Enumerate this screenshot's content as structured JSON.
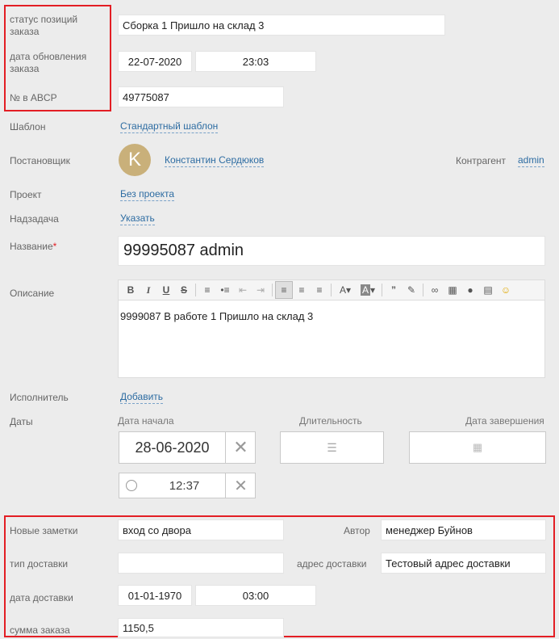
{
  "custom_top": {
    "status_label": "статус позиций заказа",
    "status_value": "Сборка 1 Пришло на склад 3",
    "update_label": "дата обновления заказа",
    "update_date": "22-07-2020",
    "update_time": "23:03",
    "abcp_label": "№ в ABCP",
    "abcp_value": "49775087"
  },
  "template": {
    "label": "Шаблон",
    "value": "Стандартный шаблон"
  },
  "creator": {
    "label": "Постановщик",
    "avatar_letter": "K",
    "name": "Константин Сердюков",
    "counterparty_label": "Контрагент",
    "counterparty_value": "admin"
  },
  "project": {
    "label": "Проект",
    "value": "Без проекта"
  },
  "parent_task": {
    "label": "Надзадача",
    "value": "Указать"
  },
  "title": {
    "label": "Название",
    "required_mark": "*",
    "value": "99995087 admin"
  },
  "description": {
    "label": "Описание",
    "text": "9999087 В работе 1 Пришло на склад 3"
  },
  "assignee": {
    "label": "Исполнитель",
    "value": "Добавить"
  },
  "dates": {
    "label": "Даты",
    "start_label": "Дата начала",
    "duration_label": "Длительность",
    "end_label": "Дата завершения",
    "start_date": "28-06-2020",
    "start_time": "12:37"
  },
  "custom_bottom": {
    "notes_label": "Новые заметки",
    "notes_value": "вход со двора",
    "author_label": "Автор",
    "author_value": "менеджер Буйнов",
    "delivery_type_label": "тип доставки",
    "delivery_type_value": "",
    "delivery_address_label": "адрес доставки",
    "delivery_address_value": "Тестовый адрес доставки",
    "delivery_date_label": "дата доставки",
    "delivery_date": "01-01-1970",
    "delivery_time": "03:00",
    "order_sum_label": "сумма заказа",
    "order_sum_value": "1150,5"
  },
  "colors": {
    "accent_link": "#2d6ca2",
    "highlight_border": "#e31e24",
    "avatar_bg": "#c9b07a"
  }
}
